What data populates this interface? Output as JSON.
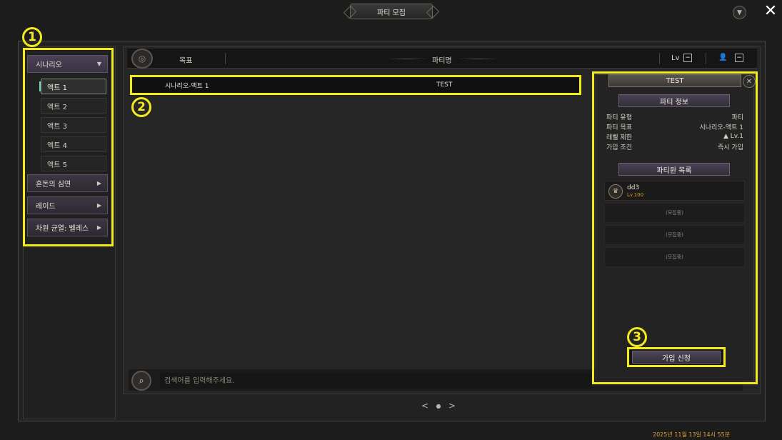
{
  "window": {
    "title": "파티 모집"
  },
  "sidebar": {
    "categories": [
      {
        "label": "시나리오",
        "expanded": true
      },
      {
        "label": "혼돈의 심연"
      },
      {
        "label": "레이드"
      },
      {
        "label": "차원 균열: 벨레스"
      }
    ],
    "scenario_items": [
      {
        "label": "액트 1",
        "selected": true
      },
      {
        "label": "액트 2"
      },
      {
        "label": "액트 3"
      },
      {
        "label": "액트 4"
      },
      {
        "label": "액트 5"
      }
    ]
  },
  "list_header": {
    "goal": "목표",
    "party_name": "파티명",
    "level": "Lv",
    "level_toggle": "−",
    "member_toggle": "−"
  },
  "party_rows": [
    {
      "goal": "시나리오-액트 1",
      "name": "TEST"
    }
  ],
  "search": {
    "placeholder": "검색어를 입력해주세요."
  },
  "detail": {
    "title": "TEST",
    "info_section": "파티 정보",
    "info": [
      {
        "label": "파티 유형",
        "value": "파티"
      },
      {
        "label": "파티 목표",
        "value": "시나리오-액트 1"
      },
      {
        "label": "레벨 제한",
        "value": "▲ Lv.1"
      },
      {
        "label": "가입 조건",
        "value": "즉시 가입"
      }
    ],
    "members_section": "파티원 목록",
    "members": [
      {
        "name": "dd3",
        "level": "Lv.100"
      }
    ],
    "empty_slots": [
      "(모집중)",
      "(모집중)",
      "(모집중)"
    ],
    "join_button": "가입 신청"
  },
  "annotations": {
    "m1": "1",
    "m2": "2",
    "m3": "3"
  },
  "footer": {
    "datetime": "2025년 11월 13일 14시 55분"
  },
  "colors": {
    "highlight": "#f3ea1c",
    "accent": "#6fd2c4",
    "datetime": "#e0a030"
  }
}
